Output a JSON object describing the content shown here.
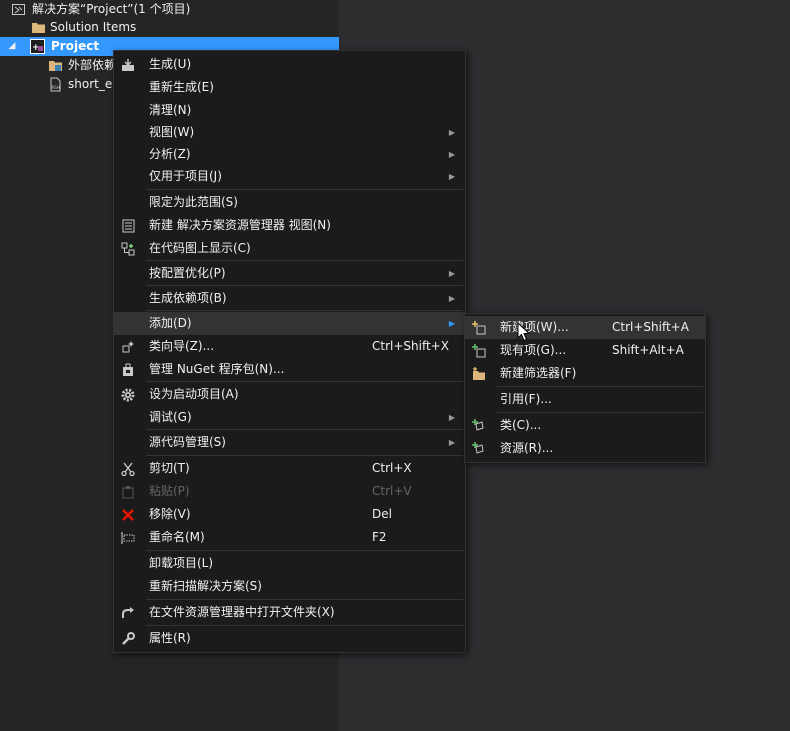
{
  "explorer": {
    "solution_label": "解决方案“Project”(1 个项目)",
    "solution_items_label": "Solution Items",
    "project_label": "Project",
    "external_deps_label": "外部依赖",
    "short_file_label": "short_e"
  },
  "context_menu": {
    "items": [
      {
        "label": "生成(U)"
      },
      {
        "label": "重新生成(E)"
      },
      {
        "label": "清理(N)"
      },
      {
        "label": "视图(W)"
      },
      {
        "label": "分析(Z)"
      },
      {
        "label": "仅用于项目(J)"
      },
      {
        "label": "限定为此范围(S)"
      },
      {
        "label": "新建 解决方案资源管理器 视图(N)"
      },
      {
        "label": "在代码图上显示(C)"
      },
      {
        "label": "按配置优化(P)"
      },
      {
        "label": "生成依赖项(B)"
      },
      {
        "label": "添加(D)"
      },
      {
        "label": "类向导(Z)...",
        "shortcut": "Ctrl+Shift+X"
      },
      {
        "label": "管理 NuGet 程序包(N)..."
      },
      {
        "label": "设为启动项目(A)"
      },
      {
        "label": "调试(G)"
      },
      {
        "label": "源代码管理(S)"
      },
      {
        "label": "剪切(T)",
        "shortcut": "Ctrl+X"
      },
      {
        "label": "粘贴(P)",
        "shortcut": "Ctrl+V"
      },
      {
        "label": "移除(V)",
        "shortcut": "Del"
      },
      {
        "label": "重命名(M)",
        "shortcut": "F2"
      },
      {
        "label": "卸载项目(L)"
      },
      {
        "label": "重新扫描解决方案(S)"
      },
      {
        "label": "在文件资源管理器中打开文件夹(X)"
      },
      {
        "label": "属性(R)"
      }
    ]
  },
  "add_submenu": {
    "items": [
      {
        "label": "新建项(W)...",
        "shortcut": "Ctrl+Shift+A"
      },
      {
        "label": "现有项(G)...",
        "shortcut": "Shift+Alt+A"
      },
      {
        "label": "新建筛选器(F)"
      },
      {
        "label": "引用(F)..."
      },
      {
        "label": "类(C)..."
      },
      {
        "label": "资源(R)..."
      }
    ]
  },
  "colors": {
    "selection": "#3399ff",
    "menu_bg": "#1b1b1c",
    "menu_hover": "#333334",
    "disabled_text": "#656565",
    "remove_icon": "#e51400"
  }
}
